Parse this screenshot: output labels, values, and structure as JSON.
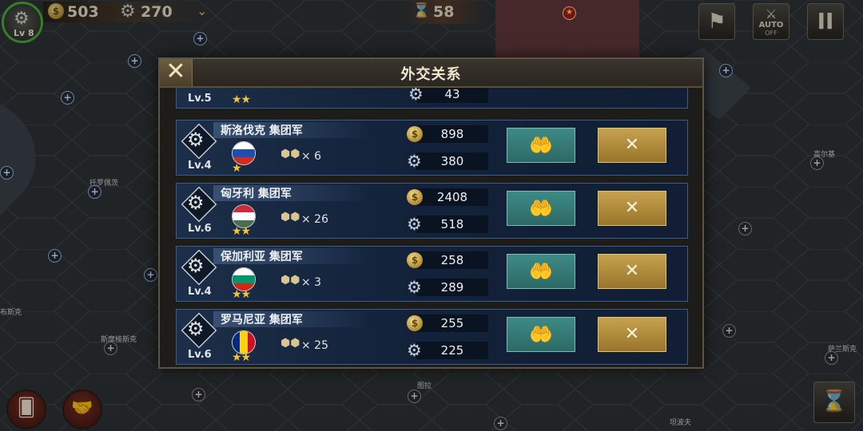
{
  "hud": {
    "player_level": "Lv 8",
    "gold": "503",
    "industry": "270",
    "turn": "58",
    "auto_label": "AUTO",
    "auto_state": "OFF"
  },
  "dialog": {
    "title": "外交关系",
    "partial_row": {
      "level": "Lv.5",
      "stars": "★★",
      "industry": "43"
    },
    "rows": [
      {
        "name": "斯洛伐克 集团军",
        "level": "Lv.4",
        "stars": "★",
        "units": "× 6",
        "gold": "898",
        "industry": "380",
        "flag": [
          "#ffffff",
          "#1b4fb0",
          "#d52b1e"
        ],
        "flag_orientation": "horizontal"
      },
      {
        "name": "匈牙利 集团军",
        "level": "Lv.6",
        "stars": "★★",
        "units": "× 26",
        "gold": "2408",
        "industry": "518",
        "flag": [
          "#ce2939",
          "#ffffff",
          "#477050"
        ],
        "flag_orientation": "horizontal"
      },
      {
        "name": "保加利亚 集团军",
        "level": "Lv.4",
        "stars": "★★",
        "units": "× 3",
        "gold": "258",
        "industry": "289",
        "flag": [
          "#ffffff",
          "#00966e",
          "#d62612"
        ],
        "flag_orientation": "horizontal"
      },
      {
        "name": "罗马尼亚 集团军",
        "level": "Lv.6",
        "stars": "★★",
        "units": "× 25",
        "gold": "255",
        "industry": "225",
        "flag": [
          "#002b7f",
          "#fcd116",
          "#ce1126"
        ],
        "flag_orientation": "vertical"
      }
    ]
  },
  "map": {
    "places": [
      "托罗佩茨",
      "高尔基",
      "斯摩棱斯克",
      "萨兰斯克",
      "图拉",
      "坦波夫",
      "布斯克"
    ]
  },
  "colors": {
    "aid_button": "#3e8a86",
    "war_button": "#c6a14e",
    "row_border": "#3a5c8c"
  }
}
